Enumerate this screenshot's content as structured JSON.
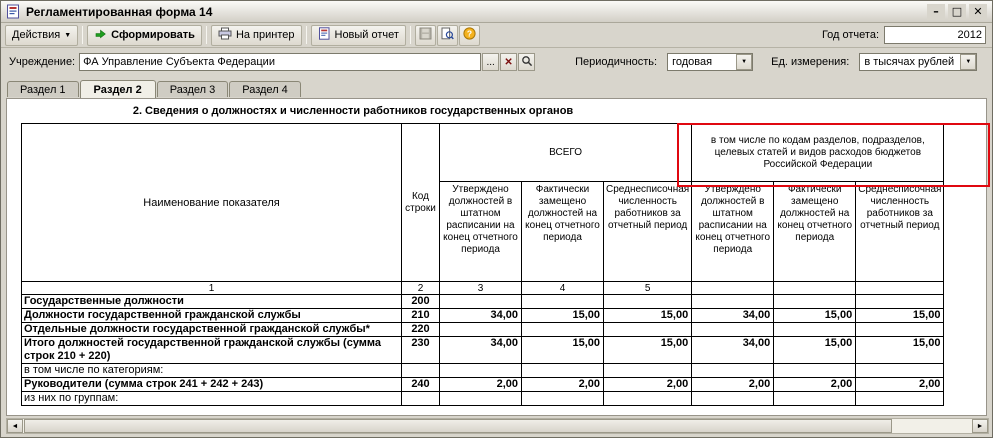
{
  "window": {
    "title": "Регламентированная форма 14",
    "minimize": "–",
    "maximize": "□",
    "close": "✕"
  },
  "toolbar": {
    "actions": "Действия",
    "generate": "Сформировать",
    "print": "На принтер",
    "new_report": "Новый отчет",
    "year_label": "Год отчета:",
    "year_value": "2012"
  },
  "filters": {
    "institution_label": "Учреждение:",
    "institution_value": "ФА Управление Субъекта Федерации",
    "choose_button": "...",
    "clear_button": "✕",
    "periodicity_label": "Периодичность:",
    "periodicity_value": "годовая",
    "units_label": "Ед. измерения:",
    "units_value": "в тысячах рублей"
  },
  "tabs": [
    {
      "label": "Раздел 1",
      "active": false
    },
    {
      "label": "Раздел 2",
      "active": true
    },
    {
      "label": "Раздел 3",
      "active": false
    },
    {
      "label": "Раздел 4",
      "active": false
    }
  ],
  "table": {
    "title": "2. Сведения о должностях и численности работников государственных органов",
    "header": {
      "name": "Наименование показателя",
      "code": "Код строки",
      "group_total": "ВСЕГО",
      "group_codes": "в том числе по кодам разделов, подразделов, целевых статей и видов расходов бюджетов Российской Федерации",
      "subcols": [
        "Утверждено должностей в штатном расписании на конец отчетного периода",
        "Фактически замещено должностей на конец отчетного периода",
        "Среднесписочная численность работников за отчетный период",
        "Утверждено должностей в штатном расписании на конец отчетного периода",
        "Фактически замещено должностей на конец отчетного периода",
        "Среднесписочная численность работников за отчетный период"
      ],
      "numbers": [
        "1",
        "2",
        "3",
        "4",
        "5",
        "",
        "",
        ""
      ]
    },
    "rows": [
      {
        "name": "Государственные  должности",
        "code": "200",
        "values": [
          "",
          "",
          "",
          "",
          "",
          ""
        ],
        "bold": true
      },
      {
        "name": "Должности государственной гражданской службы",
        "code": "210",
        "values": [
          "34,00",
          "15,00",
          "15,00",
          "34,00",
          "15,00",
          "15,00"
        ],
        "bold": true
      },
      {
        "name": "Отдельные должности государственной гражданской службы*",
        "code": "220",
        "values": [
          "",
          "",
          "",
          "",
          "",
          ""
        ],
        "bold": true
      },
      {
        "name": "Итого должностей государственной гражданской службы (сумма строк 210 + 220)",
        "code": "230",
        "values": [
          "34,00",
          "15,00",
          "15,00",
          "34,00",
          "15,00",
          "15,00"
        ],
        "bold": true
      },
      {
        "name": "в том числе по категориям:",
        "code": "",
        "values": [
          "",
          "",
          "",
          "",
          "",
          ""
        ],
        "bold": false
      },
      {
        "name": "Руководители (сумма строк 241 + 242 + 243)",
        "code": "240",
        "values": [
          "2,00",
          "2,00",
          "2,00",
          "2,00",
          "2,00",
          "2,00"
        ],
        "bold": true
      },
      {
        "name": "из них по группам:",
        "code": "",
        "values": [
          "",
          "",
          "",
          "",
          "",
          ""
        ],
        "bold": false
      }
    ]
  },
  "scrollbar": {
    "left_arrow": "◄",
    "right_arrow": "►"
  }
}
